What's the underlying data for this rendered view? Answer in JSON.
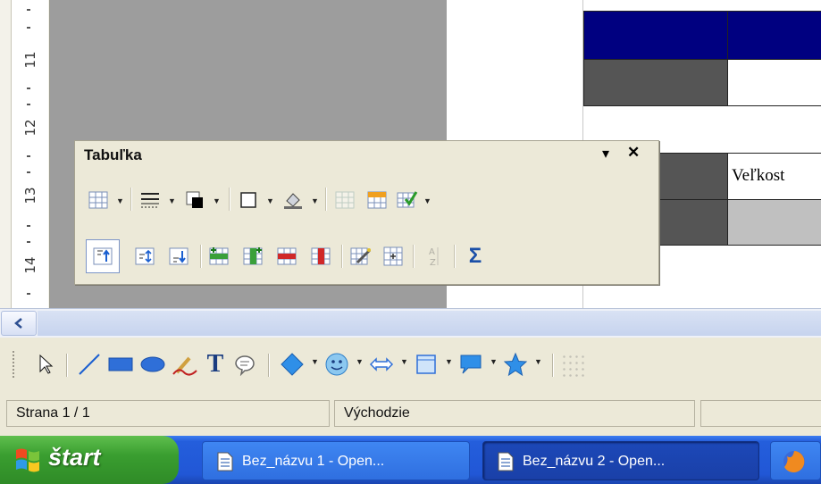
{
  "ruler": {
    "labels": [
      "11",
      "12",
      "13",
      "14"
    ]
  },
  "document": {
    "cell_text": "Veľkost"
  },
  "table_toolbar": {
    "title": "Tabuľka",
    "menu_glyph": "▾",
    "close_glyph": "✕",
    "row1": [
      "table-icon",
      "border-style-icon",
      "border-color-icon",
      "borders-icon",
      "background-color-icon",
      "merge-cells-icon",
      "split-cells-icon",
      "autoformat-icon"
    ],
    "row2": [
      "align-top-icon",
      "align-center-icon",
      "align-bottom-icon",
      "insert-rows-icon",
      "insert-columns-icon",
      "delete-rows-icon",
      "delete-columns-icon",
      "table-properties-icon",
      "cell-properties-icon",
      "sort-icon",
      "sum-icon"
    ],
    "sum_glyph": "Σ"
  },
  "drawing_toolbar": {
    "tools": [
      "select-icon",
      "line-icon",
      "rectangle-icon",
      "ellipse-icon",
      "freeform-icon",
      "text-icon",
      "callout-icon",
      "basic-shapes-icon",
      "symbol-shapes-icon",
      "block-arrows-icon",
      "flowchart-icon",
      "callouts-icon",
      "stars-icon"
    ],
    "text_glyph": "T"
  },
  "statusbar": {
    "page": "Strana 1 / 1",
    "style": "Východzie"
  },
  "taskbar": {
    "start_label": "štart",
    "tasks": [
      {
        "label": "Bez_názvu 1 - Open..."
      },
      {
        "label": "Bez_názvu 2 - Open..."
      }
    ]
  },
  "colors": {
    "header_blue": "#000080",
    "dark_gray": "#555555",
    "light_gray": "#c0c0c0",
    "taskbar_blue": "#245edc",
    "start_green": "#3a9e30"
  }
}
